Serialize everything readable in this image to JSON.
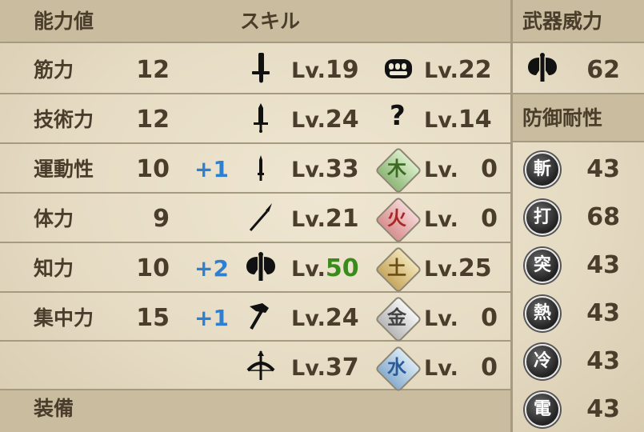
{
  "headers": {
    "stats": "能力値",
    "skills": "スキル",
    "weapon_power": "武器威力",
    "defense": "防御耐性",
    "equipment": "装備"
  },
  "stats": [
    {
      "label": "筋力",
      "value": "12",
      "bonus": ""
    },
    {
      "label": "技術力",
      "value": "12",
      "bonus": ""
    },
    {
      "label": "運動性",
      "value": "10",
      "bonus": "+1"
    },
    {
      "label": "体力",
      "value": "9",
      "bonus": ""
    },
    {
      "label": "知力",
      "value": "10",
      "bonus": "+2"
    },
    {
      "label": "集中力",
      "value": "15",
      "bonus": "+1"
    }
  ],
  "weapon_skills": [
    {
      "icon": "greatsword-icon",
      "lv_prefix": "Lv.",
      "level": "19"
    },
    {
      "icon": "sword-icon",
      "lv_prefix": "Lv.",
      "level": "24"
    },
    {
      "icon": "dagger-icon",
      "lv_prefix": "Lv.",
      "level": "33"
    },
    {
      "icon": "spear-icon",
      "lv_prefix": "Lv.",
      "level": "21"
    },
    {
      "icon": "axe-icon",
      "lv_prefix": "Lv.",
      "level": "50",
      "highlight": "#3a8a1c"
    },
    {
      "icon": "hammer-icon",
      "lv_prefix": "Lv.",
      "level": "24"
    },
    {
      "icon": "bow-icon",
      "lv_prefix": "Lv.",
      "level": "37"
    }
  ],
  "other_skills": [
    {
      "icon": "fist-icon",
      "glyph": "",
      "lv_prefix": "Lv.",
      "level": "22"
    },
    {
      "icon": "question-icon",
      "glyph": "?",
      "lv_prefix": "Lv.",
      "level": "14"
    },
    {
      "icon": "wood-element-icon",
      "glyph": "木",
      "lv_prefix": "Lv.",
      "level": "0",
      "color": "#5a8a3c"
    },
    {
      "icon": "fire-element-icon",
      "glyph": "火",
      "lv_prefix": "Lv.",
      "level": "0",
      "color": "#c23a3a"
    },
    {
      "icon": "earth-element-icon",
      "glyph": "土",
      "lv_prefix": "Lv.",
      "level": "25",
      "color": "#8a6a1c"
    },
    {
      "icon": "metal-element-icon",
      "glyph": "金",
      "lv_prefix": "Lv.",
      "level": "0",
      "color": "#6a6a6a"
    },
    {
      "icon": "water-element-icon",
      "glyph": "水",
      "lv_prefix": "Lv.",
      "level": "0",
      "color": "#3a6ab0"
    }
  ],
  "weapon_power": {
    "icon": "axe-icon",
    "value": "62"
  },
  "resistances": [
    {
      "glyph": "斬",
      "value": "43"
    },
    {
      "glyph": "打",
      "value": "68"
    },
    {
      "glyph": "突",
      "value": "43"
    },
    {
      "glyph": "熱",
      "value": "43"
    },
    {
      "glyph": "冷",
      "value": "43"
    },
    {
      "glyph": "電",
      "value": "43"
    }
  ]
}
